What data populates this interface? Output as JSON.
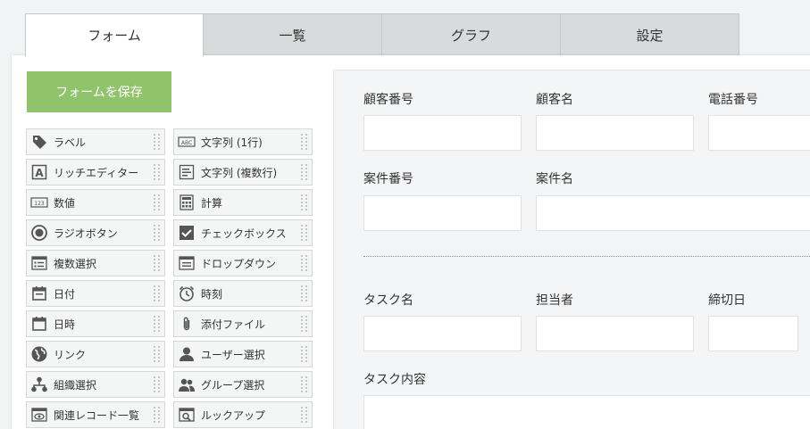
{
  "tabs": [
    {
      "label": "フォーム",
      "active": true
    },
    {
      "label": "一覧"
    },
    {
      "label": "グラフ"
    },
    {
      "label": "設定"
    }
  ],
  "save_button": "フォームを保存",
  "palette": [
    {
      "label": "ラベル",
      "icon": "tag-icon"
    },
    {
      "label": "文字列 (1行)",
      "icon": "text-single-line-icon"
    },
    {
      "label": "リッチエディター",
      "icon": "rich-editor-icon"
    },
    {
      "label": "文字列 (複数行)",
      "icon": "text-multi-line-icon"
    },
    {
      "label": "数値",
      "icon": "number-icon"
    },
    {
      "label": "計算",
      "icon": "calculator-icon"
    },
    {
      "label": "ラジオボタン",
      "icon": "radio-button-icon"
    },
    {
      "label": "チェックボックス",
      "icon": "checkbox-icon"
    },
    {
      "label": "複数選択",
      "icon": "multi-select-icon"
    },
    {
      "label": "ドロップダウン",
      "icon": "dropdown-icon"
    },
    {
      "label": "日付",
      "icon": "date-icon"
    },
    {
      "label": "時刻",
      "icon": "clock-icon"
    },
    {
      "label": "日時",
      "icon": "datetime-icon"
    },
    {
      "label": "添付ファイル",
      "icon": "paperclip-icon"
    },
    {
      "label": "リンク",
      "icon": "globe-icon"
    },
    {
      "label": "ユーザー選択",
      "icon": "user-icon"
    },
    {
      "label": "組織選択",
      "icon": "organization-icon"
    },
    {
      "label": "グループ選択",
      "icon": "group-icon"
    },
    {
      "label": "関連レコード一覧",
      "icon": "related-records-icon"
    },
    {
      "label": "ルックアップ",
      "icon": "lookup-icon"
    }
  ],
  "form": {
    "customer_number": "顧客番号",
    "customer_name": "顧客名",
    "phone_number": "電話番号",
    "case_number": "案件番号",
    "case_name": "案件名",
    "task_name": "タスク名",
    "assignee": "担当者",
    "deadline": "締切日",
    "task_content": "タスク内容"
  }
}
